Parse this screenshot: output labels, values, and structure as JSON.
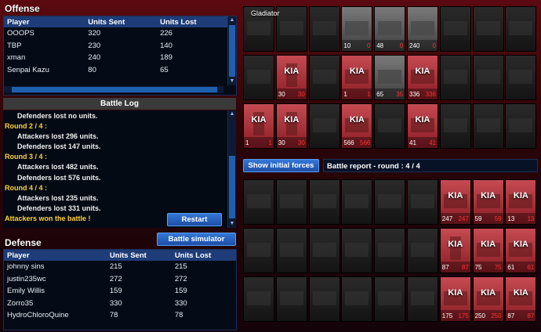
{
  "offense": {
    "title": "Offense",
    "columns": [
      "Player",
      "Units Sent",
      "Units Lost"
    ],
    "rows": [
      [
        "OOOPS",
        "320",
        "226"
      ],
      [
        "TBP",
        "230",
        "140"
      ],
      [
        "xman",
        "240",
        "189"
      ],
      [
        "Senpai Kazu",
        "80",
        "65"
      ]
    ]
  },
  "battle_log": {
    "header": "Battle Log",
    "lines": [
      {
        "type": "indent",
        "text": "Defenders lost no units."
      },
      {
        "type": "round",
        "text": "Round 2 / 4 :"
      },
      {
        "type": "indent",
        "text": "Attackers lost 296 units."
      },
      {
        "type": "indent",
        "text": "Defenders lost 147 units."
      },
      {
        "type": "round",
        "text": "Round 3 / 4 :"
      },
      {
        "type": "indent",
        "text": "Attackers lost 482 units."
      },
      {
        "type": "indent",
        "text": "Defenders lost 576 units."
      },
      {
        "type": "round",
        "text": "Round 4 / 4 :"
      },
      {
        "type": "indent",
        "text": "Attackers lost 235 units."
      },
      {
        "type": "indent",
        "text": "Defenders lost 331 units."
      },
      {
        "type": "win",
        "text": "Attackers won the battle !"
      }
    ],
    "restart_label": "Restart"
  },
  "simulator_label": "Battle simulator",
  "defense": {
    "title": "Defense",
    "columns": [
      "Player",
      "Units Sent",
      "Units Lost"
    ],
    "rows": [
      [
        "johnny sins",
        "215",
        "215"
      ],
      [
        "justin235wc",
        "272",
        "272"
      ],
      [
        "Emily Willis",
        "159",
        "159"
      ],
      [
        "Zorro35",
        "330",
        "330"
      ],
      [
        "HydroChloroQuine",
        "78",
        "78"
      ]
    ]
  },
  "attack_grid": {
    "label": "Gladiator",
    "rows": [
      [
        {
          "s": "dim"
        },
        {
          "s": "dim"
        },
        {
          "s": "dim"
        },
        {
          "s": "live",
          "n": "10",
          "l": "0"
        },
        {
          "s": "live",
          "n": "48",
          "l": "0"
        },
        {
          "s": "live",
          "n": "240",
          "l": "0"
        },
        {
          "s": "dim"
        },
        {
          "s": "dim"
        },
        {
          "s": "dim"
        }
      ],
      [
        {
          "s": "dim"
        },
        {
          "s": "kia",
          "n": "30",
          "l": "30",
          "inf": true
        },
        {
          "s": "dim"
        },
        {
          "s": "kia",
          "n": "1",
          "l": "1"
        },
        {
          "s": "live",
          "n": "65",
          "l": "35"
        },
        {
          "s": "kia",
          "n": "336",
          "l": "336"
        },
        {
          "s": "dim"
        },
        {
          "s": "dim"
        },
        {
          "s": "dim"
        }
      ],
      [
        {
          "s": "kia",
          "n": "1",
          "l": "1",
          "inf": true
        },
        {
          "s": "kia",
          "n": "30",
          "l": "30",
          "inf": true
        },
        {
          "s": "dim"
        },
        {
          "s": "kia",
          "n": "566",
          "l": "566"
        },
        {
          "s": "dim"
        },
        {
          "s": "kia",
          "n": "41",
          "l": "41"
        },
        {
          "s": "dim"
        },
        {
          "s": "dim"
        },
        {
          "s": "dim"
        }
      ]
    ]
  },
  "show_forces_label": "Show initial forces",
  "report_label": "Battle report - round : 4 / 4",
  "defense_grid": {
    "rows": [
      [
        {
          "s": "dim"
        },
        {
          "s": "dim"
        },
        {
          "s": "dim"
        },
        {
          "s": "dim"
        },
        {
          "s": "dim"
        },
        {
          "s": "dim"
        },
        {
          "s": "kia",
          "n": "247",
          "l": "247"
        },
        {
          "s": "kia",
          "n": "59",
          "l": "59"
        },
        {
          "s": "kia",
          "n": "13",
          "l": "13"
        }
      ],
      [
        {
          "s": "dim"
        },
        {
          "s": "dim"
        },
        {
          "s": "dim"
        },
        {
          "s": "dim"
        },
        {
          "s": "dim"
        },
        {
          "s": "dim"
        },
        {
          "s": "kia",
          "n": "87",
          "l": "87",
          "inf": true
        },
        {
          "s": "kia",
          "n": "75",
          "l": "75"
        },
        {
          "s": "kia",
          "n": "61",
          "l": "61"
        }
      ],
      [
        {
          "s": "dim"
        },
        {
          "s": "dim"
        },
        {
          "s": "dim"
        },
        {
          "s": "dim"
        },
        {
          "s": "dim"
        },
        {
          "s": "dim"
        },
        {
          "s": "kia",
          "n": "175",
          "l": "175"
        },
        {
          "s": "kia",
          "n": "250",
          "l": "250"
        },
        {
          "s": "kia",
          "n": "87",
          "l": "87"
        }
      ]
    ]
  },
  "kia_label": "KIA"
}
